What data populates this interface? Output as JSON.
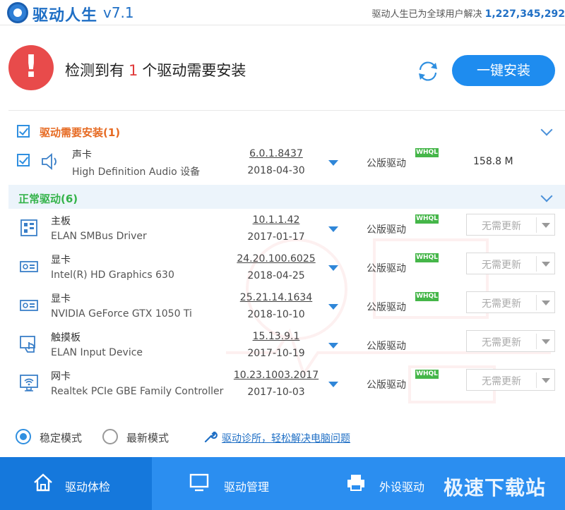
{
  "title_bar": {
    "app_name": "驱动人生",
    "version": "v7.1",
    "user_stat_text": "驱动人生已为全球用户解决",
    "user_stat_count": "1,227,345,292"
  },
  "header": {
    "alert_glyph": "!",
    "headline_prefix": "检测到有",
    "headline_count": "1",
    "headline_suffix": "个驱动需要安装",
    "install_button": "一键安装"
  },
  "sections": {
    "need_install": {
      "title": "驱动需要安装(1)"
    },
    "normal": {
      "title": "正常驱动(6)"
    }
  },
  "needed_drivers": [
    {
      "name": "声卡",
      "model": "High Definition Audio 设备",
      "version": "6.0.1.8437",
      "date": "2018-04-30",
      "type": "公版驱动",
      "badge": "WHQL",
      "size": "158.8 M",
      "icon": "speaker-icon"
    }
  ],
  "normal_drivers": [
    {
      "name": "主板",
      "model": "ELAN SMBus Driver",
      "version": "10.1.1.42",
      "date": "2017-01-17",
      "type": "公版驱动",
      "badge": "WHQL",
      "action": "无需更新",
      "icon": "motherboard-icon"
    },
    {
      "name": "显卡",
      "model": "Intel(R) HD Graphics 630",
      "version": "24.20.100.6025",
      "date": "2018-04-25",
      "type": "公版驱动",
      "badge": "WHQL",
      "action": "无需更新",
      "icon": "graphics-card-icon"
    },
    {
      "name": "显卡",
      "model": "NVIDIA GeForce GTX 1050 Ti",
      "version": "25.21.14.1634",
      "date": "2018-10-10",
      "type": "公版驱动",
      "badge": "WHQL",
      "action": "无需更新",
      "icon": "graphics-card-icon"
    },
    {
      "name": "触摸板",
      "model": "ELAN Input Device",
      "version": "15.13.9.1",
      "date": "2017-10-19",
      "type": "公版驱动",
      "badge": "",
      "action": "无需更新",
      "icon": "touchpad-icon"
    },
    {
      "name": "网卡",
      "model": "Realtek PCIe GBE Family Controller",
      "version": "10.23.1003.2017",
      "date": "2017-10-03",
      "type": "公版驱动",
      "badge": "WHQL",
      "action": "无需更新",
      "icon": "network-card-icon"
    }
  ],
  "footer": {
    "mode_stable": "稳定模式",
    "mode_latest": "最新模式",
    "diagnose_link": "驱动诊所，轻松解决电脑问题"
  },
  "bottom_nav": [
    {
      "label": "驱动体检",
      "icon": "home-icon",
      "active": true
    },
    {
      "label": "驱动管理",
      "icon": "monitor-icon",
      "active": false
    },
    {
      "label": "外设驱动",
      "icon": "printer-icon",
      "active": false
    }
  ],
  "watermark": "极速下载站",
  "colors": {
    "accent": "#1e8cef",
    "nav_bg": "#2b8ef0",
    "alert_red": "#e84b4b",
    "need_orange": "#e66a22",
    "normal_green": "#34b34a",
    "whql_green": "#45b649"
  }
}
